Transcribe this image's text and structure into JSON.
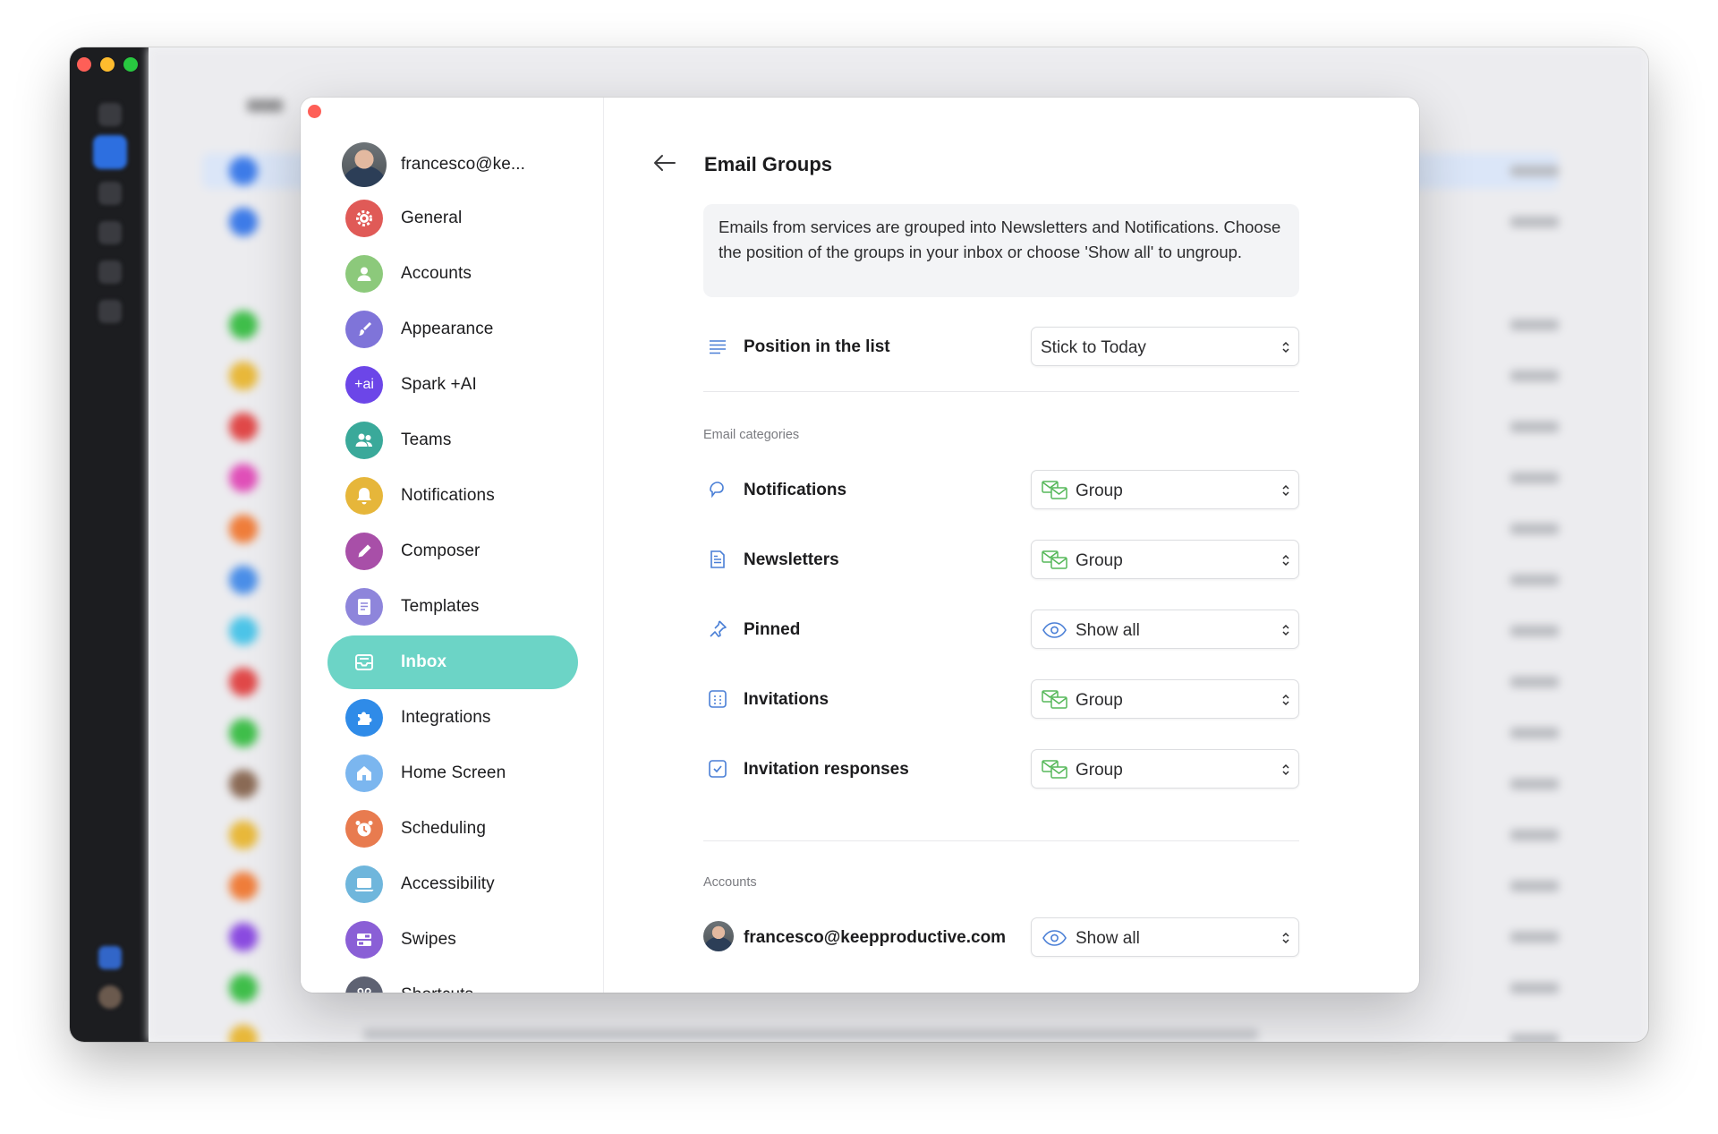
{
  "sidebar": {
    "account": "francesco@ke...",
    "items": [
      {
        "label": "General",
        "icon": "gear-icon",
        "color": "#e05a57"
      },
      {
        "label": "Accounts",
        "icon": "user-icon",
        "color": "#8cc97b"
      },
      {
        "label": "Appearance",
        "icon": "paintbrush-icon",
        "color": "#7f74d9"
      },
      {
        "label": "Spark +AI",
        "icon": "ai-icon",
        "color": "#6c46e8",
        "badge": "+ai"
      },
      {
        "label": "Teams",
        "icon": "people-icon",
        "color": "#3aa99a"
      },
      {
        "label": "Notifications",
        "icon": "bell-icon",
        "color": "#e6b63a"
      },
      {
        "label": "Composer",
        "icon": "pencil-icon",
        "color": "#a84fa8"
      },
      {
        "label": "Templates",
        "icon": "document-icon",
        "color": "#8e85db"
      },
      {
        "label": "Inbox",
        "icon": "inbox-icon",
        "color": "#6cd4c6"
      },
      {
        "label": "Integrations",
        "icon": "puzzle-icon",
        "color": "#2f8be8"
      },
      {
        "label": "Home Screen",
        "icon": "home-icon",
        "color": "#7bb6ef"
      },
      {
        "label": "Scheduling",
        "icon": "alarm-clock-icon",
        "color": "#e87b4f"
      },
      {
        "label": "Accessibility",
        "icon": "laptop-icon",
        "color": "#6fb6dc"
      },
      {
        "label": "Swipes",
        "icon": "swipe-icon",
        "color": "#8a5fd6"
      },
      {
        "label": "Shortcuts",
        "icon": "command-icon",
        "color": "#5e6272"
      }
    ]
  },
  "pane": {
    "title": "Email Groups",
    "info": "Emails from services are grouped into Newsletters and Notifications. Choose the position of the groups in your inbox or choose 'Show all' to ungroup.",
    "position_label": "Position in the list",
    "position_value": "Stick to Today",
    "categories_header": "Email categories",
    "categories": [
      {
        "label": "Notifications",
        "value": "Group",
        "icon": "megaphone-icon",
        "value_icon": "group-envelope-icon"
      },
      {
        "label": "Newsletters",
        "value": "Group",
        "icon": "newsletter-icon",
        "value_icon": "group-envelope-icon"
      },
      {
        "label": "Pinned",
        "value": "Show all",
        "icon": "pin-icon",
        "value_icon": "eye-icon"
      },
      {
        "label": "Invitations",
        "value": "Group",
        "icon": "calendar-icon",
        "value_icon": "group-envelope-icon"
      },
      {
        "label": "Invitation responses",
        "value": "Group",
        "icon": "calendar-check-icon",
        "value_icon": "group-envelope-icon"
      }
    ],
    "accounts_header": "Accounts",
    "account_row": {
      "label": "francesco@keepproductive.com",
      "value": "Show all",
      "value_icon": "eye-icon"
    }
  },
  "colors": {
    "accent": "#6cd4c6",
    "icon_blue": "#4a7fd6",
    "group_green": "#56b85a"
  }
}
